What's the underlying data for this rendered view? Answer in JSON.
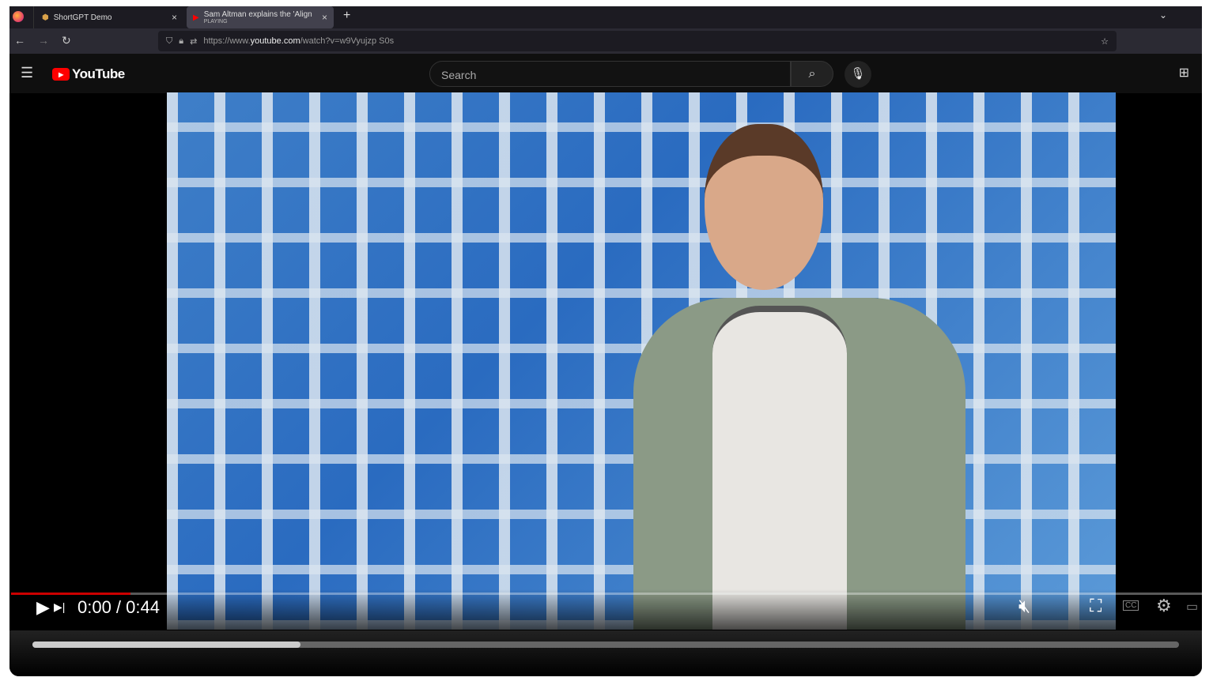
{
  "browser": {
    "tabs": [
      {
        "title": "ShortGPT Demo",
        "close": "×"
      },
      {
        "title": "Sam Altman explains the 'Align",
        "status": "PLAYING",
        "close": "×"
      }
    ],
    "new_tab": "+",
    "url_prefix": "https://www.",
    "url_domain": "youtube.com",
    "url_path": "/watch?v=w9Vyujzp S0s"
  },
  "youtube": {
    "logo": "YouTube",
    "search_placeholder": "Search"
  },
  "player": {
    "time": "0:00 / 0:44",
    "progress_fraction": 0.1,
    "scroll_fraction": 0.234
  }
}
